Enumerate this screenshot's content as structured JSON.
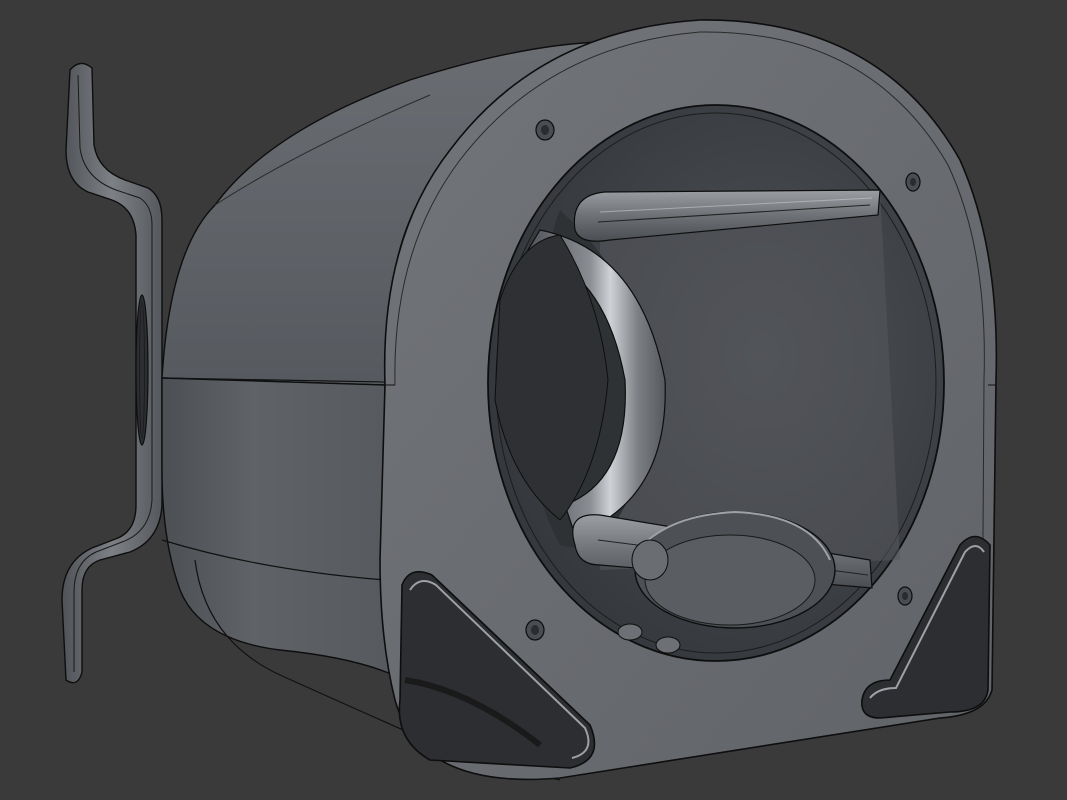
{
  "viewport": {
    "background": "#3a3a3a",
    "body_color": "#5b5e63",
    "edge_color": "#0e0e0e",
    "part": "3d-model-view"
  }
}
